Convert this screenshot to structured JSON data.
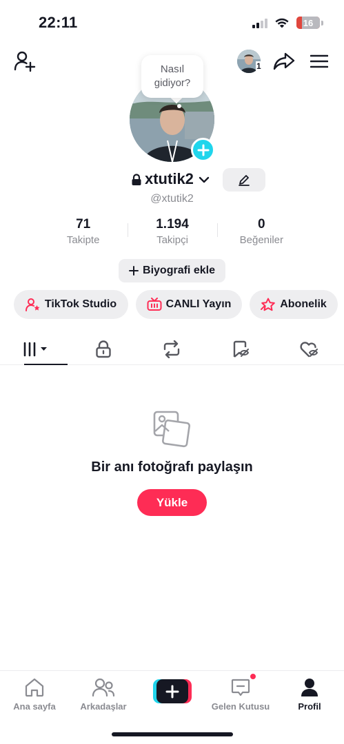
{
  "status_bar": {
    "time": "22:11",
    "battery": "16"
  },
  "header": {
    "notification_count": "1"
  },
  "bubble": {
    "text": "Nasıl gidiyor?"
  },
  "profile": {
    "username": "xtutik2",
    "handle": "@xtutik2",
    "stats": [
      {
        "value": "71",
        "label": "Takipte"
      },
      {
        "value": "1.194",
        "label": "Takipçi"
      },
      {
        "value": "0",
        "label": "Beğeniler"
      }
    ],
    "bio_button": "Biyografi ekle"
  },
  "actions": {
    "studio": "TikTok Studio",
    "live": "CANLI Yayın",
    "subscription": "Abonelik"
  },
  "tabs": [
    "videos-grid-icon",
    "lock-icon",
    "repost-icon",
    "favorites-icon",
    "liked-icon"
  ],
  "empty_state": {
    "title": "Bir anı fotoğrafı paylaşın",
    "button": "Yükle"
  },
  "nav": {
    "home": "Ana sayfa",
    "friends": "Arkadaşlar",
    "inbox": "Gelen Kutusu",
    "profile": "Profil"
  },
  "colors": {
    "accent": "#fe2c55",
    "cyan": "#20d5ec",
    "text": "#161823",
    "muted": "#8a8b91",
    "pill_bg": "#eeeef0"
  }
}
